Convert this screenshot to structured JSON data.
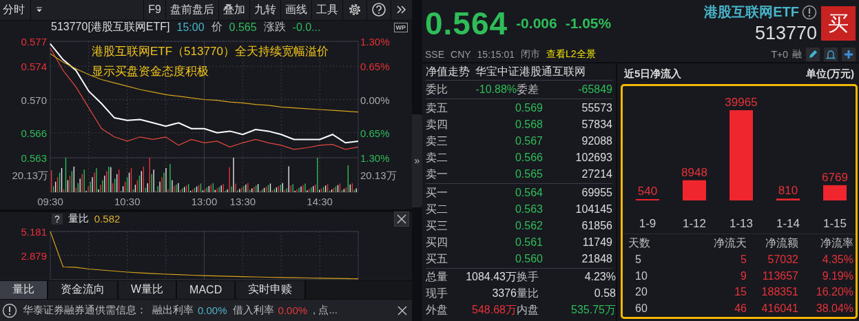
{
  "left": {
    "toolbar": {
      "mode": "分时",
      "buttons": [
        "F9",
        "盘前盘后",
        "叠加",
        "九转",
        "画线",
        "工具"
      ],
      "wp_badge": "WP"
    },
    "quote_line": {
      "symbol": "513770[港股互联网ETF]",
      "time": "15:00",
      "price_label": "价",
      "price": "0.565",
      "change_label": "涨跌",
      "change": "-0.0...",
      "color": "#2fbd5a"
    },
    "price_chart": {
      "chart_data": {
        "type": "line",
        "categories": [
          "09:30",
          null,
          null,
          null,
          null,
          null,
          "10:30",
          null,
          null,
          null,
          null,
          null,
          "13:00",
          null,
          null,
          "13:30",
          null,
          null,
          null,
          null,
          null,
          "14:30",
          null,
          null,
          null
        ],
        "series": [
          {
            "color": "#ffffff",
            "values": [
              0.5767,
              0.5748,
              0.5735,
              0.571,
              0.5695,
              0.5678,
              0.5675,
              0.5676,
              0.5672,
              0.5668,
              0.5672,
              0.5665,
              0.5665,
              0.566,
              0.5662,
              0.5658,
              0.5664,
              0.5662,
              0.5658,
              0.5652,
              0.5652,
              0.5652,
              0.5658,
              0.5648,
              0.565
            ]
          },
          {
            "color": "#e5483e",
            "values": [
              0.5762,
              0.5735,
              0.5715,
              0.569,
              0.5665,
              0.5655,
              0.565,
              0.5655,
              0.5652,
              0.5655,
              0.5645,
              0.5652,
              0.5648,
              0.565,
              0.5643,
              0.5648,
              0.5652,
              0.5648,
              0.5645,
              0.564,
              0.5642,
              0.5645,
              0.5646,
              0.564,
              0.5643
            ]
          },
          {
            "color": "#d8a31c",
            "values": [
              0.5755,
              0.5745,
              0.5737,
              0.573,
              0.5724,
              0.572,
              0.5716,
              0.5712,
              0.5709,
              0.5706,
              0.5704,
              0.5702,
              0.57,
              0.5699,
              0.5697,
              0.5696,
              0.5694,
              0.5693,
              0.5691,
              0.569,
              0.5689,
              0.5688,
              0.5687,
              0.5686,
              0.5685
            ]
          }
        ],
        "ylim": [
          0.563,
          0.577
        ],
        "grid": true,
        "yticks": [
          {
            "value": 0.577,
            "label": "0.577"
          },
          {
            "value": 0.574,
            "label": "0.574"
          },
          {
            "value": 0.57,
            "label": "0.570"
          },
          {
            "value": 0.566,
            "label": "0.566"
          },
          {
            "value": 0.563,
            "label": "0.563"
          }
        ],
        "annotations": [
          "港股互联网ETF（513770）全天持续宽幅溢价",
          "显示买盘资金态度积极"
        ]
      },
      "right_axis_labels": [
        "1.30%",
        "0.65%",
        "0.00%",
        "0.65%",
        "1.30%"
      ],
      "volume_labels": [
        "20.13万",
        "20.13万"
      ]
    },
    "indicator": {
      "help": "?",
      "name": "量比",
      "value": "0.582",
      "chart_data": {
        "type": "line",
        "categories": [
          null,
          null,
          null,
          null,
          null,
          null,
          null,
          null,
          null,
          null,
          null,
          null,
          null,
          null,
          null,
          null,
          null,
          null,
          null,
          null,
          null,
          null,
          null,
          null,
          null
        ],
        "series": [
          {
            "color": "#d8a31c",
            "values": [
              5.181,
              1.75,
              1.7,
              1.55,
              1.45,
              1.35,
              1.25,
              1.17,
              1.1,
              1.05,
              1.0,
              0.95,
              0.9,
              0.87,
              0.84,
              0.81,
              0.78,
              0.75,
              0.72,
              0.7,
              0.68,
              0.66,
              0.64,
              0.62,
              0.6
            ]
          }
        ],
        "ylim": [
          0.58,
          5.181
        ],
        "grid": true,
        "yticks": [
          {
            "value": 5.181,
            "label": "5.181"
          },
          {
            "value": 2.879,
            "label": "2.879"
          }
        ]
      }
    },
    "tabs": [
      {
        "label": "量比",
        "selected": true
      },
      {
        "label": "资金流向",
        "selected": false
      },
      {
        "label": "W量比",
        "selected": false
      },
      {
        "label": "MACD",
        "selected": false
      },
      {
        "label": "实时申赎",
        "selected": false
      }
    ],
    "notice": {
      "text": "华泰证券融券通供需信息：",
      "items": [
        {
          "label": "融出利率",
          "value": "0.00%",
          "color": "#4fb3c7"
        },
        {
          "label": "借入利率",
          "value": "0.00%",
          "color": "#e5383b"
        }
      ],
      "tail": ", 点..."
    }
  },
  "splitter": {
    "expand": "»"
  },
  "quote": {
    "price": "0.564",
    "change": "-0.006",
    "change_pct": "-1.05%",
    "color": "#2fbd5a",
    "exchange": "SSE",
    "currency": "CNY",
    "time": "15:15:01",
    "status": "闭市",
    "l2_link": "查看L2全景",
    "name": "港股互联网ETF",
    "code": "513770",
    "buy_button": "买",
    "tags": [
      "T+0",
      "融"
    ]
  },
  "order_book": {
    "nav_label": "净值走势",
    "index_name": "华宝中证港股通互联网",
    "ratio": [
      {
        "label": "委比",
        "value": "-10.88%",
        "color": "#2fbd5a"
      },
      {
        "label": "委差",
        "value": "-65849",
        "color": "#2fbd5a"
      }
    ],
    "asks": [
      {
        "label": "卖五",
        "price": "0.569",
        "volume": "55573"
      },
      {
        "label": "卖四",
        "price": "0.568",
        "volume": "57834"
      },
      {
        "label": "卖三",
        "price": "0.567",
        "volume": "92088"
      },
      {
        "label": "卖二",
        "price": "0.566",
        "volume": "102693"
      },
      {
        "label": "卖一",
        "price": "0.565",
        "volume": "27214"
      }
    ],
    "bids": [
      {
        "label": "买一",
        "price": "0.564",
        "volume": "69955"
      },
      {
        "label": "买二",
        "price": "0.563",
        "volume": "104145"
      },
      {
        "label": "买三",
        "price": "0.562",
        "volume": "61856"
      },
      {
        "label": "买四",
        "price": "0.561",
        "volume": "11749"
      },
      {
        "label": "买五",
        "price": "0.560",
        "volume": "21848"
      }
    ],
    "stats": [
      [
        {
          "label": "总量",
          "value": "1084.43万",
          "color": "#dedede"
        },
        {
          "label": "换手",
          "value": "4.23%",
          "color": "#dedede"
        }
      ],
      [
        {
          "label": "现手",
          "value": "3376",
          "color": "#dedede"
        },
        {
          "label": "量比",
          "value": "0.58",
          "color": "#dedede"
        }
      ],
      [
        {
          "label": "外盘",
          "value": "548.68万",
          "color": "#e8323a"
        },
        {
          "label": "内盘",
          "value": "535.75万",
          "color": "#2fbd5a"
        }
      ]
    ]
  },
  "net_inflow": {
    "title": "近5日净流入",
    "unit": "单位(万元)",
    "chart_data": {
      "type": "bar",
      "categories": [
        "1-9",
        "1-12",
        "1-13",
        "1-14",
        "1-15"
      ],
      "series": [
        {
          "color": "#f0262e",
          "values": [
            540,
            8948,
            39965,
            810,
            6769
          ]
        }
      ],
      "data_labels": true
    },
    "table": {
      "columns": [
        "天数",
        "净流天",
        "净流额",
        "净流率"
      ],
      "rows": [
        [
          "5",
          "5",
          "57032",
          "4.35%"
        ],
        [
          "10",
          "9",
          "113657",
          "9.19%"
        ],
        [
          "20",
          "15",
          "188351",
          "16.20%"
        ],
        [
          "60",
          "46",
          "416041",
          "38.04%"
        ]
      ]
    }
  }
}
